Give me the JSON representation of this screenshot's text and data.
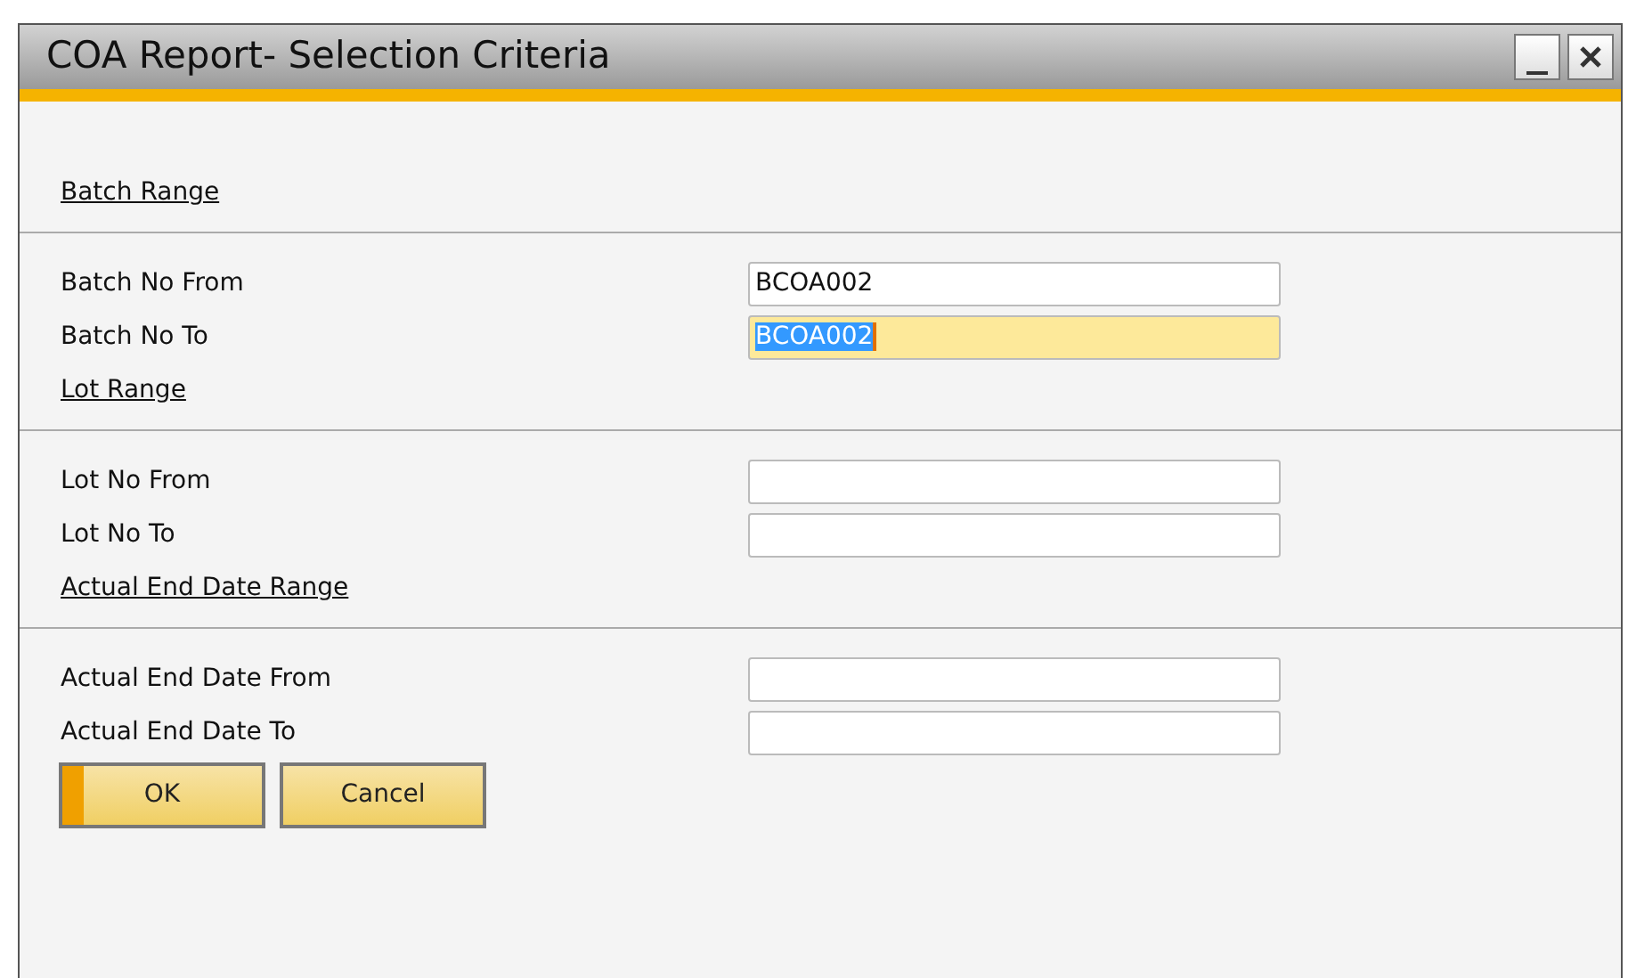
{
  "window": {
    "title": "COA Report- Selection Criteria"
  },
  "sections": [
    {
      "heading": "Batch Range",
      "fields": [
        {
          "label": "Batch No From",
          "value": "BCOA002",
          "focused": false
        },
        {
          "label": "Batch No To",
          "value": "BCOA002",
          "focused": true
        }
      ]
    },
    {
      "heading": "Lot Range",
      "fields": [
        {
          "label": "Lot No From",
          "focused": false
        },
        {
          "label": "Lot No To",
          "focused": false
        }
      ]
    },
    {
      "heading": "Actual End Date Range",
      "fields": [
        {
          "label": "Actual End Date From",
          "focused": false
        },
        {
          "label": "Actual End Date To",
          "focused": false
        }
      ]
    }
  ],
  "buttons": [
    {
      "label": "OK",
      "default": true
    },
    {
      "label": "Cancel",
      "default": false
    }
  ]
}
